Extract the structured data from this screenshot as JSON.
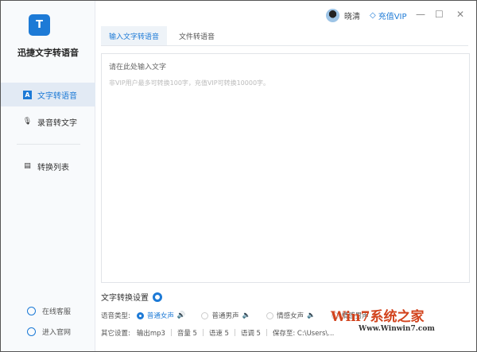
{
  "app": {
    "title": "迅捷文字转语音",
    "logo_letter": "T"
  },
  "sidebar": {
    "items": [
      {
        "label": "文字转语音",
        "icon": "A"
      },
      {
        "label": "录音转文字",
        "icon": "mic-icon"
      },
      {
        "label": "转换列表",
        "icon": "list-icon"
      }
    ],
    "bottom": [
      {
        "label": "在线客服"
      },
      {
        "label": "进入官网"
      }
    ]
  },
  "header": {
    "username": "晓清",
    "vip_label": "充值VIP",
    "minimize": "—",
    "maximize": "☐",
    "close": "✕"
  },
  "tabs": [
    {
      "label": "输入文字转语音"
    },
    {
      "label": "文件转语音"
    }
  ],
  "editor": {
    "placeholder": "请在此处输入文字",
    "hint": "非VIP用户最多可转换100字，充值VIP可转换10000字。"
  },
  "settings": {
    "title": "文字转换设置",
    "voice_label": "语音类型:",
    "voices": [
      "普通女声",
      "普通男声",
      "情感女声",
      "情感男声"
    ],
    "other_label": "其它设置:",
    "output": "输出mp3",
    "volume": "音量 5",
    "speed": "语速 5",
    "pitch": "语调 5",
    "save": "保存至: C:\\Users\\..."
  },
  "watermark": {
    "title": "Win7系统之家",
    "url": "Www.Winwin7.com"
  },
  "colors": {
    "accent": "#1d7ad6"
  }
}
